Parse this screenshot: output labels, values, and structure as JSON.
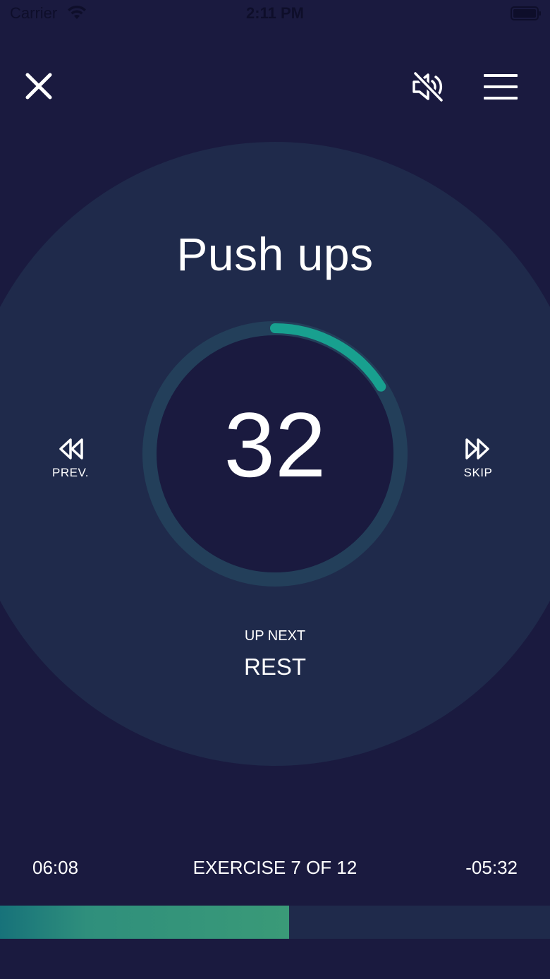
{
  "status_bar": {
    "carrier": "Carrier",
    "time": "2:11 PM"
  },
  "toolbar": {
    "close_icon": "close-icon",
    "mute_icon": "speaker-muted-icon",
    "menu_icon": "hamburger-menu-icon"
  },
  "workout": {
    "exercise_name": "Push ups",
    "timer_value": "32",
    "timer_progress": 0.16,
    "prev_label": "PREV.",
    "skip_label": "SKIP",
    "up_next_label": "UP NEXT",
    "up_next_value": "REST"
  },
  "footer": {
    "elapsed": "06:08",
    "exercise_count": "EXERCISE 7 OF 12",
    "remaining": "-05:32",
    "progress": 0.526
  },
  "colors": {
    "background": "#1a1a3f",
    "circle": "#1f2a4b",
    "ring_track": "#233f5a",
    "ring_fill": "#18a08f",
    "progress_fill": "#3a9a78",
    "text": "#ffffff"
  }
}
